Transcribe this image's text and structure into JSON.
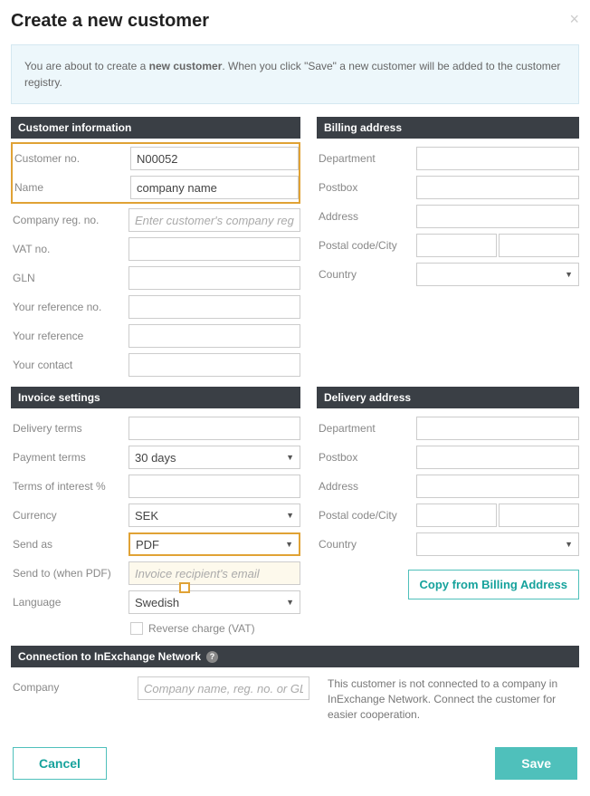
{
  "modal": {
    "title": "Create a new customer",
    "close_icon": "×"
  },
  "alert": {
    "prefix": "You are about to create a ",
    "bold": "new customer",
    "suffix": ". When you click \"Save\" a new customer will be added to the customer registry."
  },
  "sections": {
    "customer_info": "Customer information",
    "billing": "Billing address",
    "invoice": "Invoice settings",
    "delivery": "Delivery address",
    "connection": "Connection to InExchange Network"
  },
  "customer": {
    "no_label": "Customer no.",
    "no_value": "N00052",
    "name_label": "Name",
    "name_value": "company name",
    "regno_label": "Company reg. no.",
    "regno_placeholder": "Enter customer's company reg. no.",
    "vat_label": "VAT no.",
    "gln_label": "GLN",
    "your_ref_no_label": "Your reference no.",
    "your_ref_label": "Your reference",
    "your_contact_label": "Your contact"
  },
  "billing": {
    "dept_label": "Department",
    "postbox_label": "Postbox",
    "address_label": "Address",
    "postal_label": "Postal code/City",
    "country_label": "Country"
  },
  "invoice": {
    "delivery_terms_label": "Delivery terms",
    "payment_terms_label": "Payment terms",
    "payment_terms_value": "30 days",
    "terms_interest_label": "Terms of interest %",
    "currency_label": "Currency",
    "currency_value": "SEK",
    "send_as_label": "Send as",
    "send_as_value": "PDF",
    "send_to_label": "Send to (when PDF)",
    "send_to_placeholder": "Invoice recipient's email",
    "language_label": "Language",
    "language_value": "Swedish",
    "reverse_charge_label": "Reverse charge (VAT)"
  },
  "delivery": {
    "dept_label": "Department",
    "postbox_label": "Postbox",
    "address_label": "Address",
    "postal_label": "Postal code/City",
    "country_label": "Country",
    "copy_button": "Copy from Billing Address"
  },
  "connection": {
    "company_label": "Company",
    "company_placeholder": "Company name, reg. no. or GLN",
    "help_text": "This customer is not connected to a company in InExchange Network. Connect the customer for easier cooperation.",
    "help_icon": "?"
  },
  "footer": {
    "cancel": "Cancel",
    "save": "Save"
  }
}
